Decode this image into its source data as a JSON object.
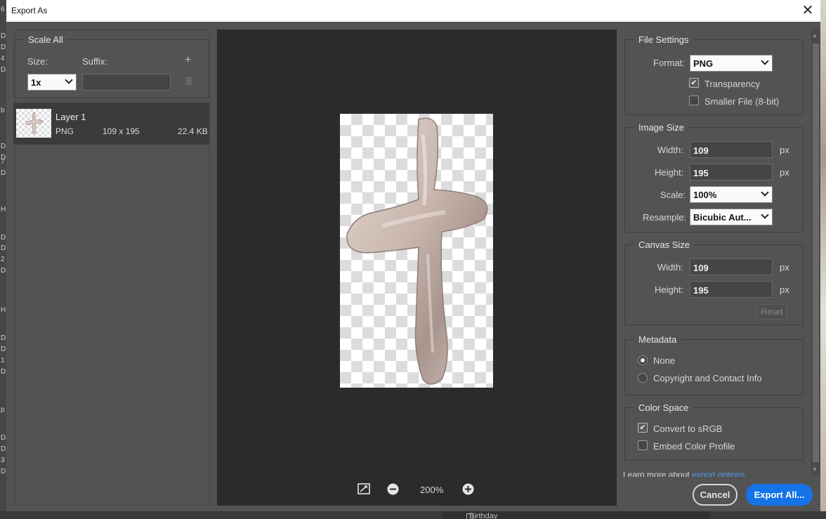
{
  "window": {
    "title": "Export As"
  },
  "background": {
    "left_letters": [
      "6",
      "D",
      "D",
      "4",
      "D",
      "b",
      "D",
      "D",
      "7",
      "D",
      "H",
      "D",
      "D",
      "2",
      "D",
      "H",
      "D",
      "D",
      "1",
      "D",
      "p",
      "D",
      "D",
      "3",
      "D"
    ],
    "bottom_text": "Birthday"
  },
  "scale_all": {
    "title": "Scale All",
    "size_label": "Size:",
    "suffix_label": "Suffix:",
    "size_value": "1x",
    "suffix_value": "",
    "add_symbol": "+"
  },
  "layer": {
    "name": "Layer 1",
    "format": "PNG",
    "dimensions": "109 x 195",
    "file_size": "22.4 KB"
  },
  "preview": {
    "zoom": "200%"
  },
  "file_settings": {
    "title": "File Settings",
    "format_label": "Format:",
    "format_value": "PNG",
    "transparency_label": "Transparency",
    "transparency_checked": true,
    "smaller_file_label": "Smaller File (8-bit)",
    "smaller_file_checked": false
  },
  "image_size": {
    "title": "Image Size",
    "width_label": "Width:",
    "width_value": "109",
    "height_label": "Height:",
    "height_value": "195",
    "scale_label": "Scale:",
    "scale_value": "100%",
    "resample_label": "Resample:",
    "resample_value": "Bicubic Aut...",
    "unit": "px"
  },
  "canvas_size": {
    "title": "Canvas Size",
    "width_label": "Width:",
    "width_value": "109",
    "height_label": "Height:",
    "height_value": "195",
    "unit": "px",
    "reset_label": "Reset"
  },
  "metadata": {
    "title": "Metadata",
    "options": [
      "None",
      "Copyright and Contact Info"
    ],
    "selected": "None"
  },
  "color_space": {
    "title": "Color Space",
    "convert_label": "Convert to sRGB",
    "convert_checked": true,
    "embed_label": "Embed Color Profile",
    "embed_checked": false
  },
  "footer": {
    "learn_more_text": "Learn more about",
    "learn_more_link": "export options",
    "cancel_label": "Cancel",
    "export_label": "Export All..."
  },
  "colors": {
    "dialog_bg": "#535353",
    "preview_bg": "#2b2b2b",
    "accent": "#1473e6",
    "link": "#4d9cf4"
  }
}
